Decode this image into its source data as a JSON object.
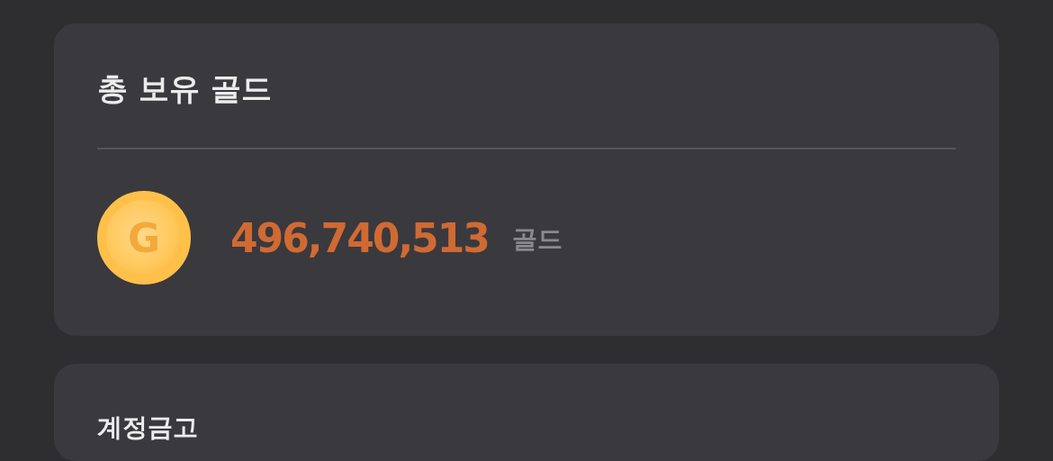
{
  "gold_card": {
    "title": "총 보유 골드",
    "coin_letter": "G",
    "amount": "496,740,513",
    "unit": "골드"
  },
  "vault_card": {
    "title": "계정금고"
  }
}
